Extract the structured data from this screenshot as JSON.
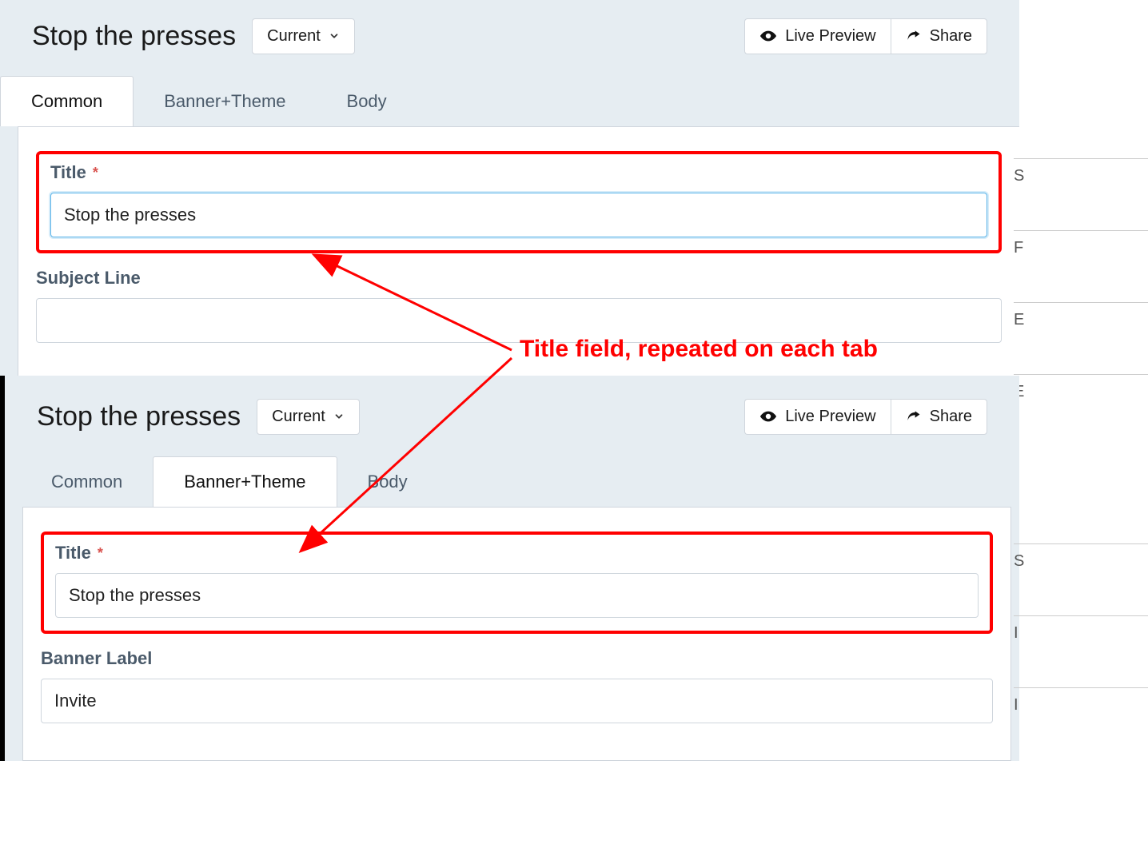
{
  "panel1": {
    "header": {
      "title": "Stop the presses",
      "version_button": "Current",
      "preview_button": "Live Preview",
      "share_button": "Share"
    },
    "tabs": [
      "Common",
      "Banner+Theme",
      "Body"
    ],
    "active_tab": 0,
    "fields": {
      "title_label": "Title",
      "title_value": "Stop the presses",
      "subject_label": "Subject Line",
      "subject_value": ""
    }
  },
  "panel2": {
    "header": {
      "title": "Stop the presses",
      "version_button": "Current",
      "preview_button": "Live Preview",
      "share_button": "Share"
    },
    "tabs": [
      "Common",
      "Banner+Theme",
      "Body"
    ],
    "active_tab": 1,
    "fields": {
      "title_label": "Title",
      "title_value": "Stop the presses",
      "banner_label_label": "Banner Label",
      "banner_label_value": "Invite"
    }
  },
  "annotation": "Title field, repeated on each tab",
  "required_marker": "*"
}
